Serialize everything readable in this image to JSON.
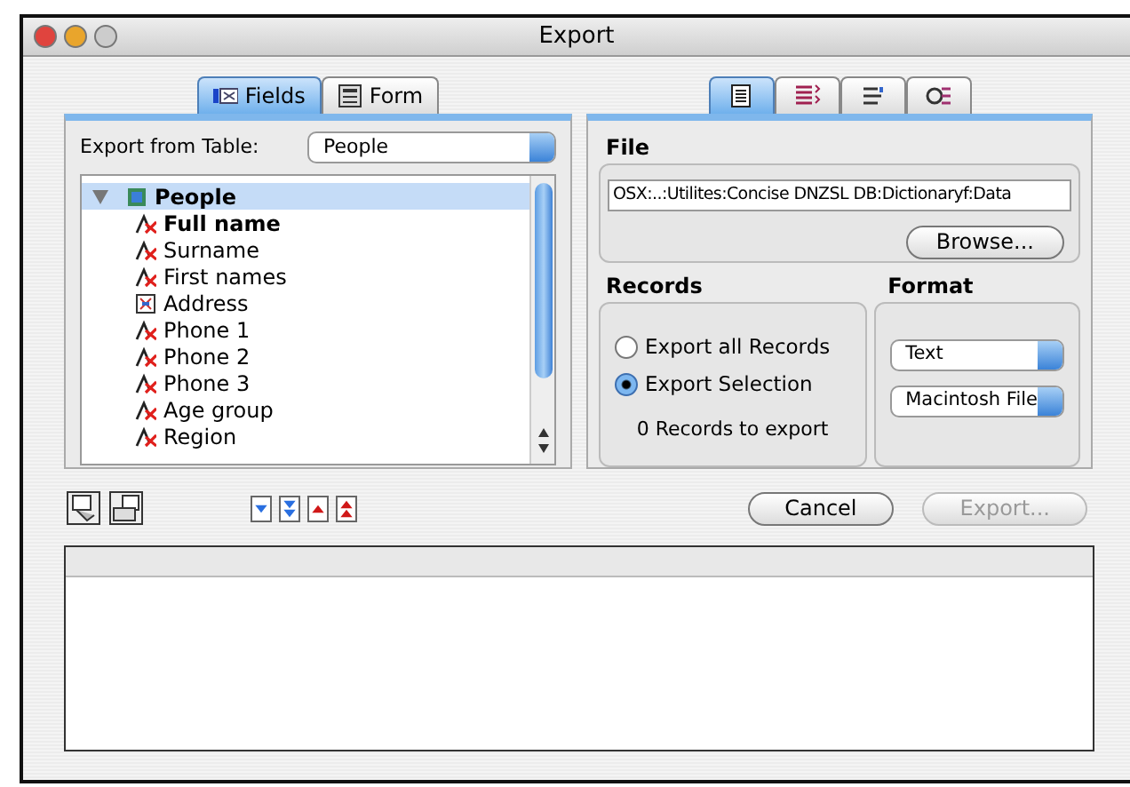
{
  "window": {
    "title": "Export"
  },
  "left_tabs": [
    {
      "label": "Fields",
      "kind": "fields",
      "selected": true
    },
    {
      "label": "Form",
      "kind": "form",
      "selected": false
    }
  ],
  "export_from_table": {
    "label": "Export from Table:",
    "value": "People"
  },
  "tree": [
    {
      "label": "People",
      "kind": "table",
      "expanded": true,
      "selected": true,
      "children": [
        {
          "label": "Full name",
          "kind": "text",
          "emphasized": true
        },
        {
          "label": "Surname",
          "kind": "text",
          "emphasized": false
        },
        {
          "label": "First names",
          "kind": "text",
          "emphasized": false
        },
        {
          "label": "Address",
          "kind": "picture",
          "emphasized": false
        },
        {
          "label": "Phone 1",
          "kind": "text",
          "emphasized": false
        },
        {
          "label": "Phone 2",
          "kind": "text",
          "emphasized": false
        },
        {
          "label": "Phone 3",
          "kind": "text",
          "emphasized": false
        },
        {
          "label": "Age group",
          "kind": "text",
          "emphasized": false
        },
        {
          "label": "Region",
          "kind": "text",
          "emphasized": false
        }
      ]
    }
  ],
  "right_tabs": [
    {
      "kind": "document",
      "selected": true
    },
    {
      "kind": "list",
      "selected": false
    },
    {
      "kind": "lines",
      "selected": false
    },
    {
      "kind": "symbols",
      "selected": false
    }
  ],
  "file": {
    "title": "File",
    "path": "OSX:..:Utilites:Concise DNZSL DB:Dictionaryf:Data",
    "button": "Browse..."
  },
  "records": {
    "title": "Records",
    "options": [
      {
        "label": "Export all Records",
        "selected": false
      },
      {
        "label": "Export Selection",
        "selected": true
      }
    ],
    "count": "0",
    "count_label": "Records to export"
  },
  "format": {
    "title": "Format",
    "selects": [
      "Text",
      "Macintosh File"
    ]
  },
  "toolbar": [
    {
      "kind": "load"
    },
    {
      "kind": "save"
    },
    {
      "kind": "down"
    },
    {
      "kind": "bottom"
    },
    {
      "kind": "up"
    },
    {
      "kind": "top"
    }
  ],
  "buttons": [
    {
      "label": "Cancel",
      "disabled": false
    },
    {
      "label": "Export...",
      "disabled": true
    }
  ]
}
